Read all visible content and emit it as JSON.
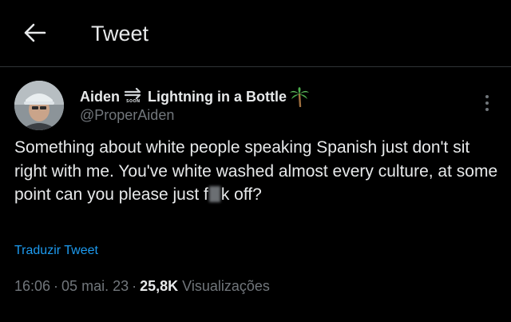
{
  "header": {
    "title": "Tweet",
    "back_icon": "arrow-left-icon"
  },
  "tweet": {
    "author": {
      "display_name_part1": "Aiden",
      "soon_label": "SOON",
      "display_name_part2": "Lightning in a Bottle",
      "handle": "@ProperAiden",
      "icons": [
        "arrow-soon-icon",
        "palm-tree-icon"
      ]
    },
    "text_before_censor": "Something about white people speaking Spanish just don't sit right with me. You've white washed almost every culture, at some point can you please just f",
    "text_after_censor": "k off?",
    "translate_label": "Traduzir Tweet",
    "time": "16:06",
    "date": "05 mai. 23",
    "separator": "·",
    "views_count": "25,8K",
    "views_label": "Visualizações"
  },
  "colors": {
    "background": "#000000",
    "text": "#e7e9ea",
    "muted": "#71767b",
    "link": "#1d9bf0",
    "divider": "#2f3336"
  }
}
